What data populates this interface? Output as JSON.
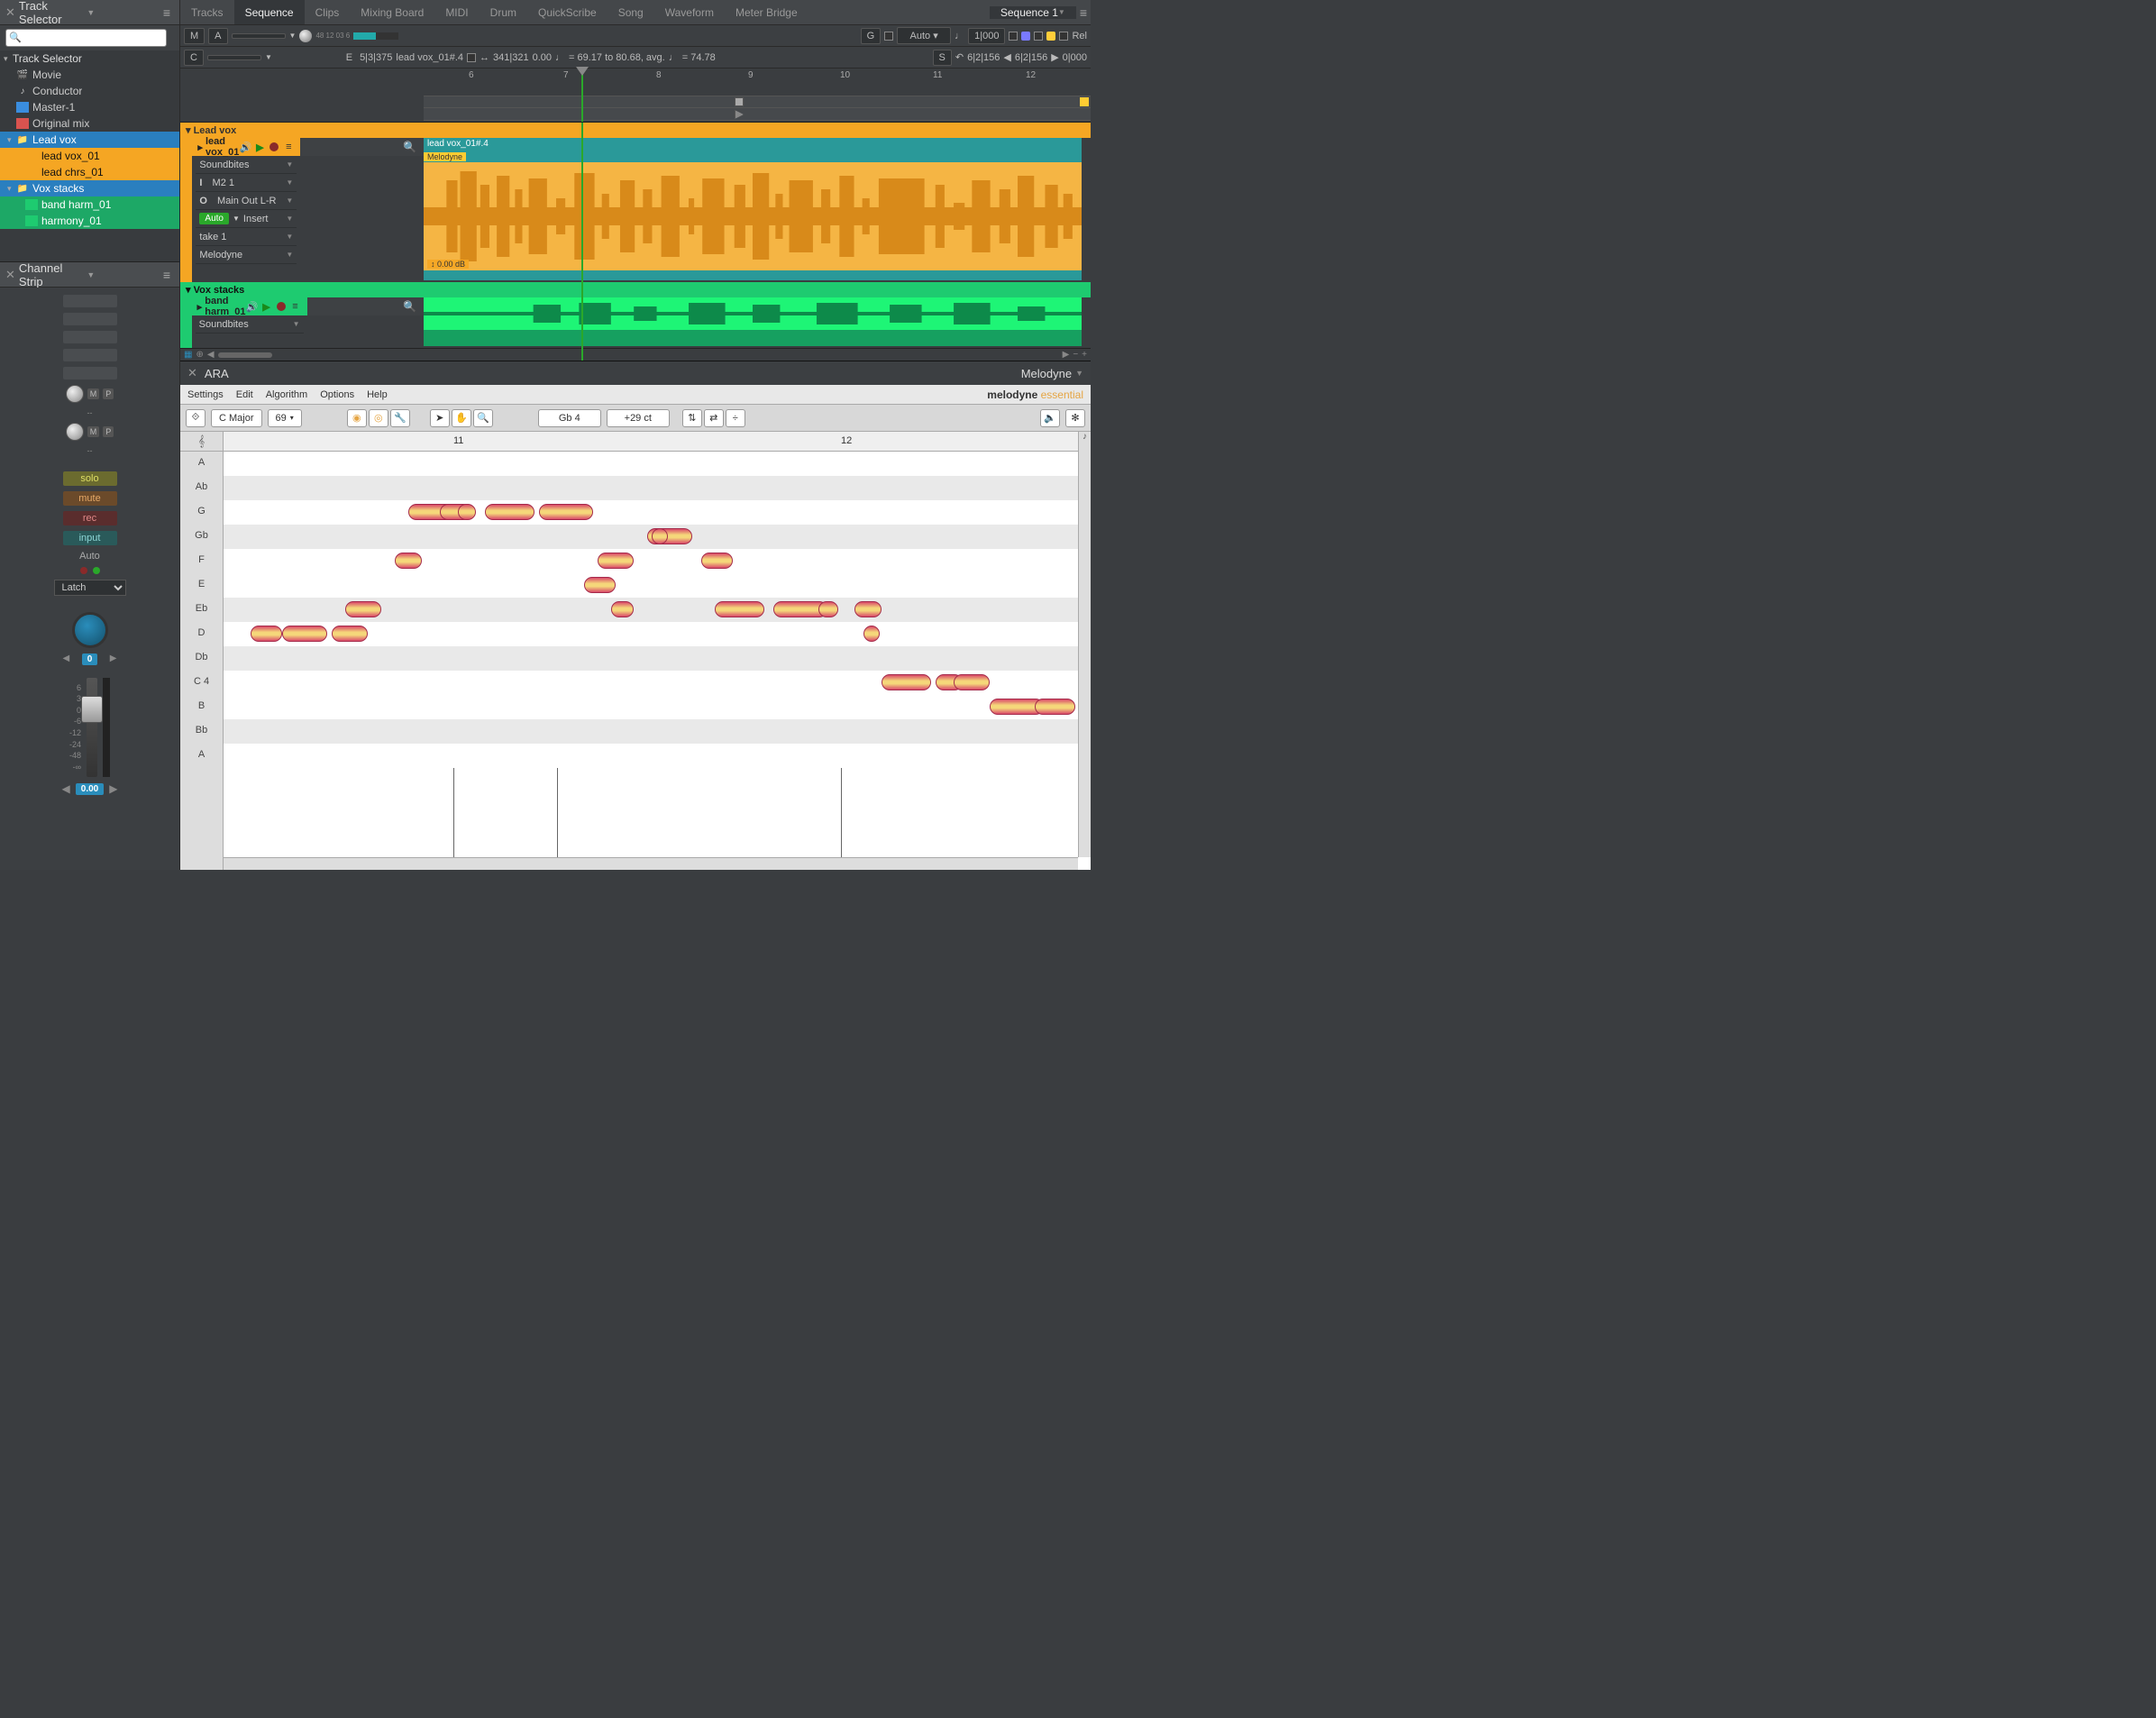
{
  "trackSelector": {
    "title": "Track Selector",
    "header": "Track Selector",
    "items": [
      {
        "label": "Movie",
        "icon": "film",
        "indent": 1
      },
      {
        "label": "Conductor",
        "icon": "baton",
        "indent": 1
      },
      {
        "label": "Master-1",
        "icon": "blue",
        "indent": 1
      },
      {
        "label": "Original mix",
        "icon": "red",
        "indent": 1
      },
      {
        "label": "Lead vox",
        "icon": "folder-o",
        "sel": "blue",
        "indent": 0,
        "arrow": "▾"
      },
      {
        "label": "lead vox_01",
        "icon": "flag-o",
        "sel": "orange",
        "indent": 1
      },
      {
        "label": "lead chrs_01",
        "icon": "flag-o",
        "sel": "orange",
        "indent": 1
      },
      {
        "label": "Vox stacks",
        "icon": "folder-g",
        "sel": "blue",
        "indent": 0,
        "arrow": "▾"
      },
      {
        "label": "band harm_01",
        "icon": "flag-g",
        "sel": "green",
        "indent": 1
      },
      {
        "label": "harmony_01",
        "icon": "flag-g",
        "sel": "green",
        "indent": 1
      }
    ]
  },
  "channelStrip": {
    "title": "Channel Strip",
    "solo": "solo",
    "mute": "mute",
    "rec": "rec",
    "input": "input",
    "auto": "Auto",
    "mode": "Latch",
    "pan": "0",
    "fader": "0.00",
    "scale": [
      "6",
      "3",
      "0",
      "-6",
      "-12",
      "-24",
      "-48",
      "-∞"
    ]
  },
  "tabs": [
    "Tracks",
    "Sequence",
    "Clips",
    "Mixing Board",
    "MIDI",
    "Drum",
    "QuickScribe",
    "Song",
    "Waveform",
    "Meter Bridge"
  ],
  "activeTab": "Sequence",
  "seqMenu": "Sequence 1",
  "toolbar1": {
    "M": "M",
    "A": "A",
    "G": "G",
    "auto": "Auto",
    "time": "1|000",
    "Rel": "Rel"
  },
  "toolbar2": {
    "C": "C",
    "E": "E",
    "pos": "5|3|375",
    "clip": "lead vox_01#.4",
    "dur": "341|321",
    "durv": "0.00",
    "tempo": "= 69.17 to 80.68, avg.",
    "tempo2": "= 74.78",
    "S": "S",
    "sel1": "6|2|156",
    "sel2": "6|2|156",
    "len": "0|000"
  },
  "rulerNums": [
    "6",
    "7",
    "8",
    "9",
    "10",
    "11",
    "12"
  ],
  "tracks": {
    "leadVox": {
      "folder": "Lead vox",
      "name": "lead vox_01",
      "soundbites": "Soundbites",
      "input": "M2 1",
      "output": "Main Out L-R",
      "auto": "Auto",
      "insert": "Insert",
      "take": "take 1",
      "plugin": "Melodyne",
      "clipName": "lead vox_01#.4",
      "clipPlugin": "Melodyne",
      "db": "0.00 dB"
    },
    "voxStacks": {
      "folder": "Vox stacks",
      "name": "band harm_01",
      "soundbites": "Soundbites"
    }
  },
  "ara": {
    "title": "ARA",
    "plugin": "Melodyne",
    "menu": [
      "Settings",
      "Edit",
      "Algorithm",
      "Options",
      "Help"
    ],
    "key": "C Major",
    "a4": "69",
    "note": "Gb 4",
    "cents": "+29 ct",
    "bars": [
      "11",
      "12"
    ],
    "pitches": [
      "A",
      "Ab",
      "G",
      "Gb",
      "F",
      "E",
      "Eb",
      "D",
      "Db",
      "C 4",
      "B",
      "Bb",
      "A"
    ]
  }
}
